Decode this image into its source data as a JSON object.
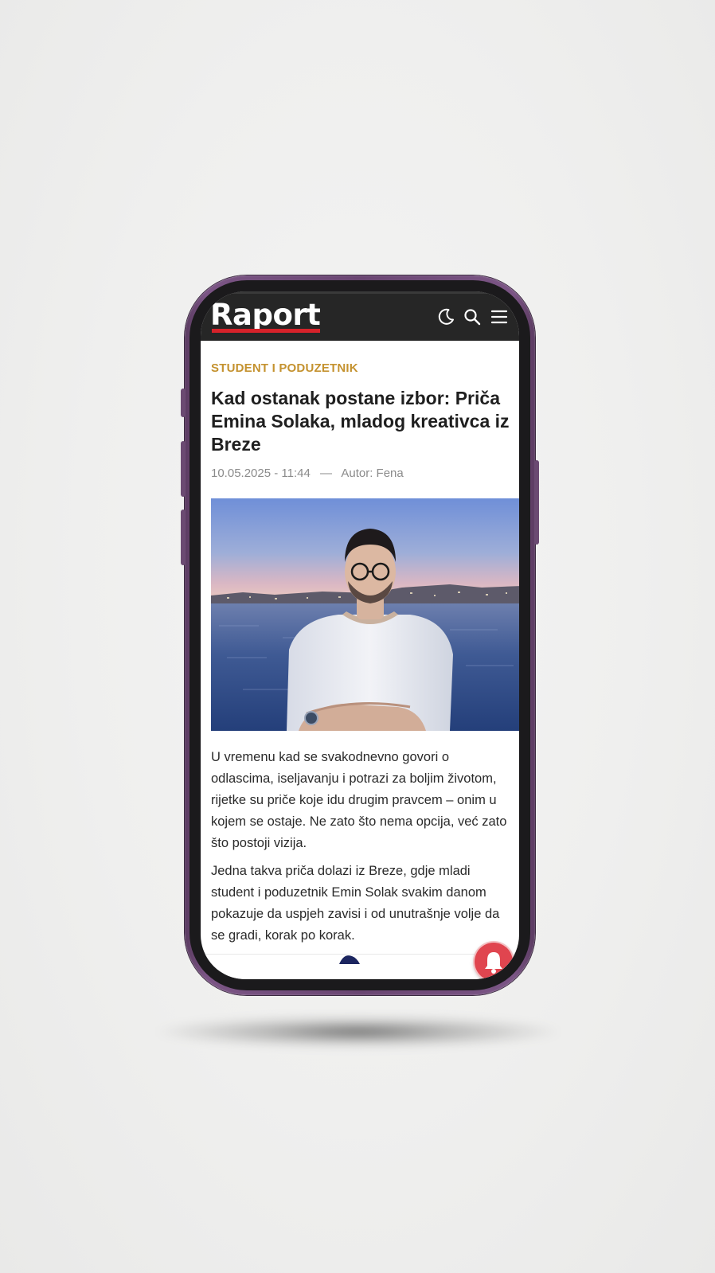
{
  "app": {
    "logo_text": "Raport",
    "brand_color": "#d6222a",
    "header_icons": [
      "moon-icon",
      "search-icon",
      "menu-icon"
    ]
  },
  "article": {
    "category": "STUDENT I PODUZETNIK",
    "category_color": "#c4922f",
    "title": "Kad ostanak postane izbor: Priča Emina Solaka, mladog kreativca iz Breze",
    "date": "10.05.2025 - 11:44",
    "separator": "—",
    "author": "Autor: Fena",
    "paragraphs": [
      "U vremenu kad se svakodnevno govori o odlascima, iseljavanju i potrazi za boljim životom, rijetke su priče koje idu drugim pravcem – onim u kojem se ostaje. Ne zato što nema opcija, već zato što postoji vizija.",
      "Jedna takva priča dolazi iz Breze, gdje mladi student i poduzetnik Emin Solak svakim danom pokazuje da uspjeh zavisi i od unutrašnje volje da se gradi, korak po korak."
    ]
  },
  "notification_button": {
    "icon": "bell-icon",
    "color": "#e0454f"
  }
}
